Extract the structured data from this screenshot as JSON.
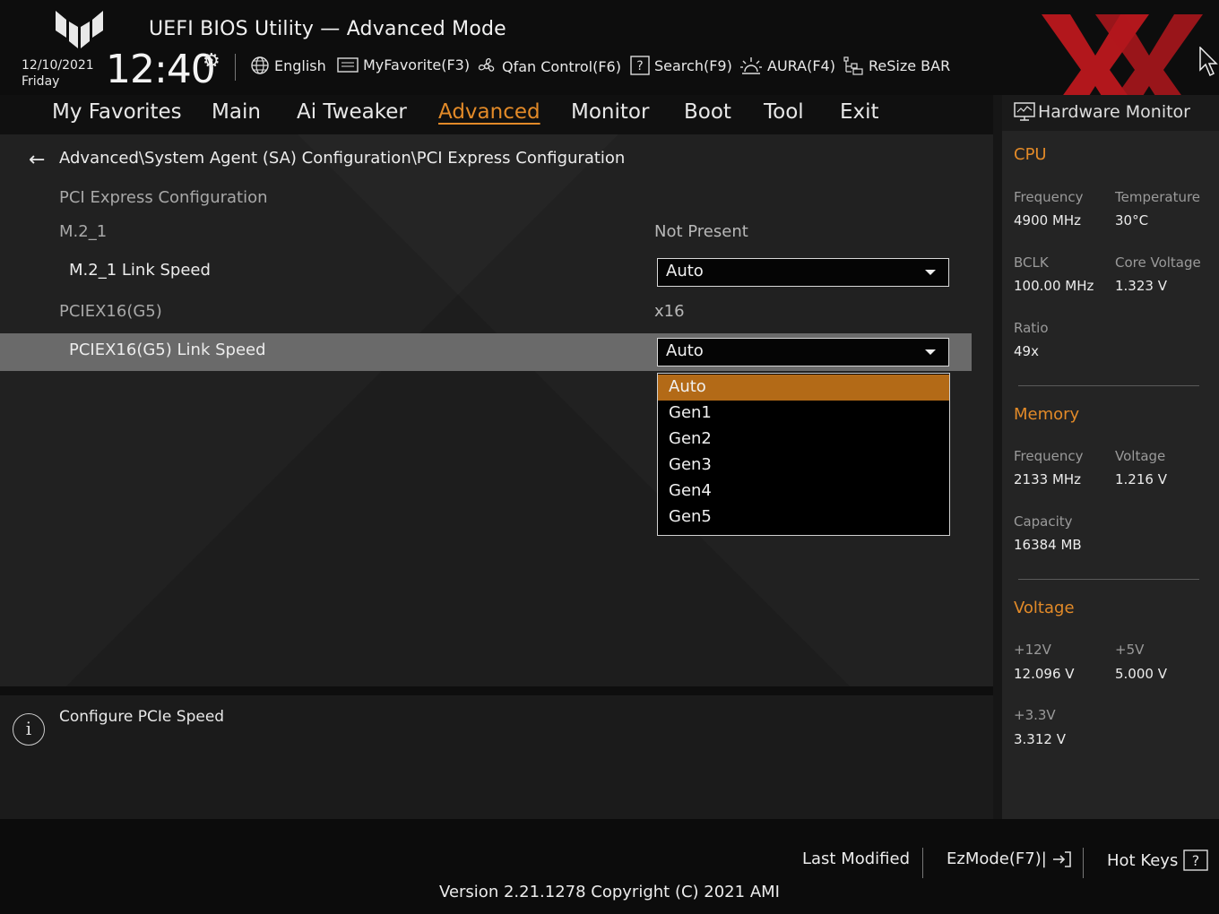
{
  "header": {
    "title": "UEFI BIOS Utility — Advanced Mode",
    "date": "12/10/2021",
    "day": "Friday",
    "time": "12:40",
    "tools": {
      "language": "English",
      "favorite": "MyFavorite(F3)",
      "qfan": "Qfan Control(F6)",
      "search": "Search(F9)",
      "aura": "AURA(F4)",
      "resize_bar": "ReSize BAR"
    }
  },
  "nav": {
    "tabs": [
      "My Favorites",
      "Main",
      "Ai Tweaker",
      "Advanced",
      "Monitor",
      "Boot",
      "Tool",
      "Exit"
    ],
    "active": "Advanced"
  },
  "main": {
    "breadcrumb": "Advanced\\System Agent (SA) Configuration\\PCI Express Configuration",
    "section_title": "PCI Express Configuration",
    "items": [
      {
        "label": "M.2_1",
        "value": "Not Present"
      },
      {
        "label": "M.2_1 Link Speed",
        "value": "Auto"
      },
      {
        "label": "PCIEX16(G5)",
        "value": "x16"
      },
      {
        "label": "PCIEX16(G5) Link Speed",
        "value": "Auto"
      }
    ],
    "dropdown": {
      "options": [
        "Auto",
        "Gen1",
        "Gen2",
        "Gen3",
        "Gen4",
        "Gen5"
      ],
      "selected": "Auto"
    }
  },
  "info": {
    "text": "Configure PCIe Speed"
  },
  "hardware_monitor": {
    "title": "Hardware Monitor",
    "cpu": {
      "heading": "CPU",
      "frequency_label": "Frequency",
      "frequency": "4900 MHz",
      "temperature_label": "Temperature",
      "temperature": "30°C",
      "bclk_label": "BCLK",
      "bclk": "100.00 MHz",
      "core_voltage_label": "Core Voltage",
      "core_voltage": "1.323 V",
      "ratio_label": "Ratio",
      "ratio": "49x"
    },
    "memory": {
      "heading": "Memory",
      "frequency_label": "Frequency",
      "frequency": "2133 MHz",
      "voltage_label": "Voltage",
      "voltage": "1.216 V",
      "capacity_label": "Capacity",
      "capacity": "16384 MB"
    },
    "voltage": {
      "heading": "Voltage",
      "v12_label": "+12V",
      "v12": "12.096 V",
      "v5_label": "+5V",
      "v5": "5.000 V",
      "v33_label": "+3.3V",
      "v33": "3.312 V"
    }
  },
  "footer": {
    "last_modified": "Last Modified",
    "ezmode": "EzMode(F7)|",
    "hotkeys": "Hot Keys",
    "version": "Version 2.21.1278 Copyright (C) 2021 AMI"
  },
  "colors": {
    "accent": "#e28a28",
    "selected_option": "#b36a17",
    "watermark": "#c0181e"
  }
}
